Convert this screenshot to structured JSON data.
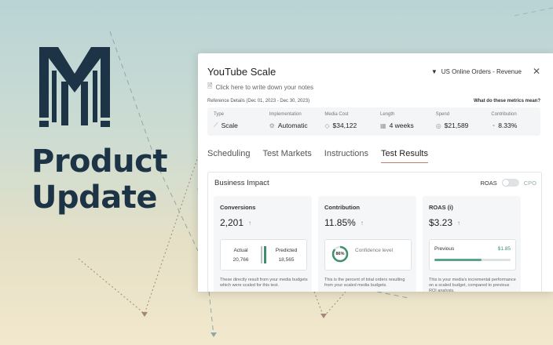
{
  "colors": {
    "brand": "#1d3447",
    "accent_tab": "#c97a6b",
    "green": "#3f8f6e"
  },
  "headline": {
    "line1": "Product",
    "line2": "Update"
  },
  "card": {
    "title": "YouTube Scale",
    "note": "Click here to write down your notes",
    "filter": {
      "icon": "filter-icon",
      "label": "US Online Orders - Revenue"
    },
    "close_icon": "close-icon",
    "reference": "Reference Details (Dec 01, 2023 - Dec 30, 2023)",
    "reference_link": "What do these metrics mean?",
    "metrics": [
      {
        "label": "Type",
        "value": "Scale",
        "icon": "trend-icon",
        "glyph": "⟋"
      },
      {
        "label": "Implementation",
        "value": "Automatic",
        "icon": "gear-icon",
        "glyph": "⚙"
      },
      {
        "label": "Media Cost",
        "value": "$34,122",
        "icon": "tag-icon",
        "glyph": "◇"
      },
      {
        "label": "Length",
        "value": "4 weeks",
        "icon": "calendar-icon",
        "glyph": "▦"
      },
      {
        "label": "Spend",
        "value": "$21,589",
        "icon": "coin-icon",
        "glyph": "◎"
      },
      {
        "label": "Contribution",
        "value": "8.33%",
        "icon": "pie-icon",
        "glyph": "◔"
      }
    ],
    "tabs": [
      "Scheduling",
      "Test Markets",
      "Instructions",
      "Test Results"
    ],
    "active_tab": "Test Results",
    "panel": {
      "title": "Business Impact",
      "toggle_left": "ROAS",
      "toggle_right": "CPO",
      "conversions": {
        "title": "Conversions",
        "value": "2,201",
        "arrow": "↑",
        "actual_label": "Actual",
        "actual_value": "20,766",
        "predicted_label": "Predicted",
        "predicted_value": "18,565",
        "desc": "These directly result from your media budgets which were scaled for this test."
      },
      "contribution": {
        "title": "Contribution",
        "value": "11.85%",
        "arrow": "↑",
        "confidence_pct": "86%",
        "confidence_fraction": 0.86,
        "confidence_label": "Confidence level",
        "desc": "This is the percent of total orders resulting from your scaled media budgets."
      },
      "roas": {
        "title": "ROAS (i)",
        "value": "$3.23",
        "arrow": "↑",
        "previous_label": "Previous",
        "previous_value": "$1.85",
        "progress_fraction": 0.62,
        "desc": "This is your media's incremental performance on a scaled budget, compared to previous ROI analysis."
      }
    }
  }
}
